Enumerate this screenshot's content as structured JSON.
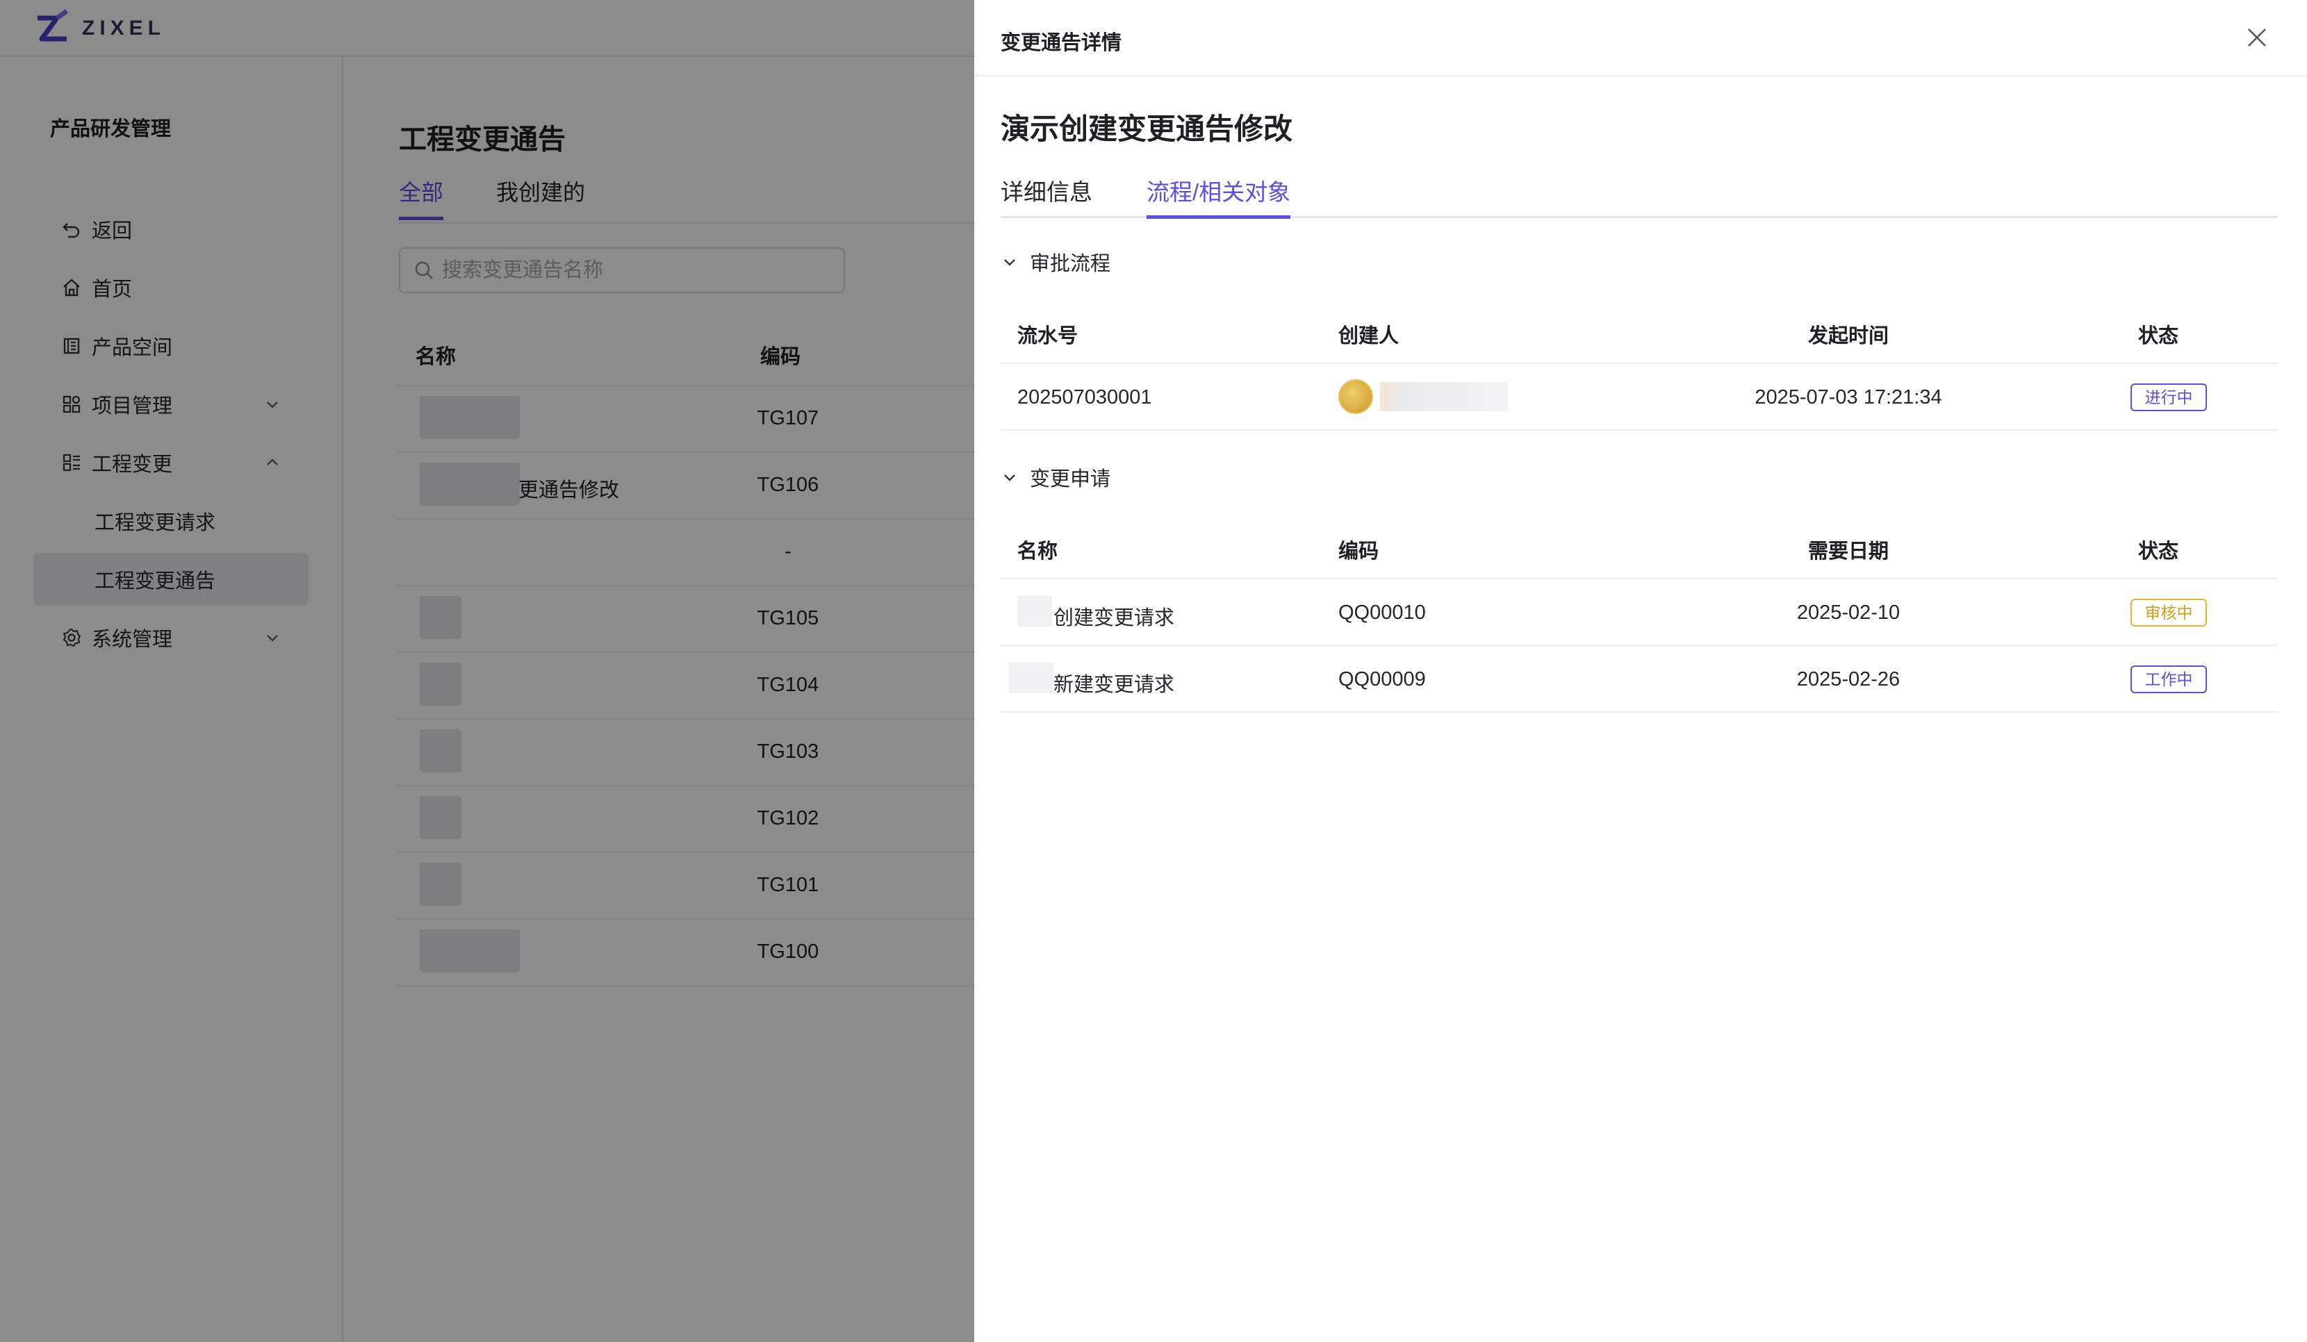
{
  "app": {
    "logo_text": "ZIXEL"
  },
  "sidebar": {
    "title": "产品研发管理",
    "items": [
      {
        "label": "返回",
        "icon": "back-icon"
      },
      {
        "label": "首页",
        "icon": "home-icon"
      },
      {
        "label": "产品空间",
        "icon": "book-icon"
      },
      {
        "label": "项目管理",
        "icon": "grid-icon"
      },
      {
        "label": "工程变更",
        "icon": "list-icon"
      },
      {
        "label": "工程变更请求",
        "icon": ""
      },
      {
        "label": "工程变更通告",
        "icon": ""
      },
      {
        "label": "系统管理",
        "icon": "gear-icon"
      }
    ]
  },
  "main": {
    "title": "工程变更通告",
    "tabs": [
      {
        "label": "全部"
      },
      {
        "label": "我创建的"
      }
    ],
    "search_placeholder": "搜索变更通告名称",
    "columns": [
      "名称",
      "编码"
    ],
    "rows": [
      {
        "name": "",
        "code": "TG107"
      },
      {
        "name": "更通告修改",
        "code": "TG106"
      },
      {
        "name": "",
        "code": "-"
      },
      {
        "name": "",
        "code": "TG105"
      },
      {
        "name": "",
        "code": "TG104"
      },
      {
        "name": "",
        "code": "TG103"
      },
      {
        "name": "",
        "code": "TG102"
      },
      {
        "name": "",
        "code": "TG101"
      },
      {
        "name": "",
        "code": "TG100"
      }
    ]
  },
  "drawer": {
    "header_title": "变更通告详情",
    "title": "演示创建变更通告修改",
    "tabs": [
      {
        "label": "详细信息"
      },
      {
        "label": "流程/相关对象"
      }
    ],
    "approval": {
      "section_title": "审批流程",
      "columns": [
        "流水号",
        "创建人",
        "发起时间",
        "状态"
      ],
      "rows": [
        {
          "serial": "202507030001",
          "time": "2025-07-03 17:21:34",
          "status": "进行中"
        }
      ]
    },
    "change_requests": {
      "section_title": "变更申请",
      "columns": [
        "名称",
        "编码",
        "需要日期",
        "状态"
      ],
      "rows": [
        {
          "name": "创建变更请求",
          "code": "QQ00010",
          "date": "2025-02-10",
          "status": "审核中"
        },
        {
          "name": "新建变更请求",
          "code": "QQ00009",
          "date": "2025-02-26",
          "status": "工作中"
        }
      ]
    }
  },
  "colors": {
    "accent": "#5b4ee0",
    "warning": "#e5b42e",
    "success": "#3ea86b"
  }
}
